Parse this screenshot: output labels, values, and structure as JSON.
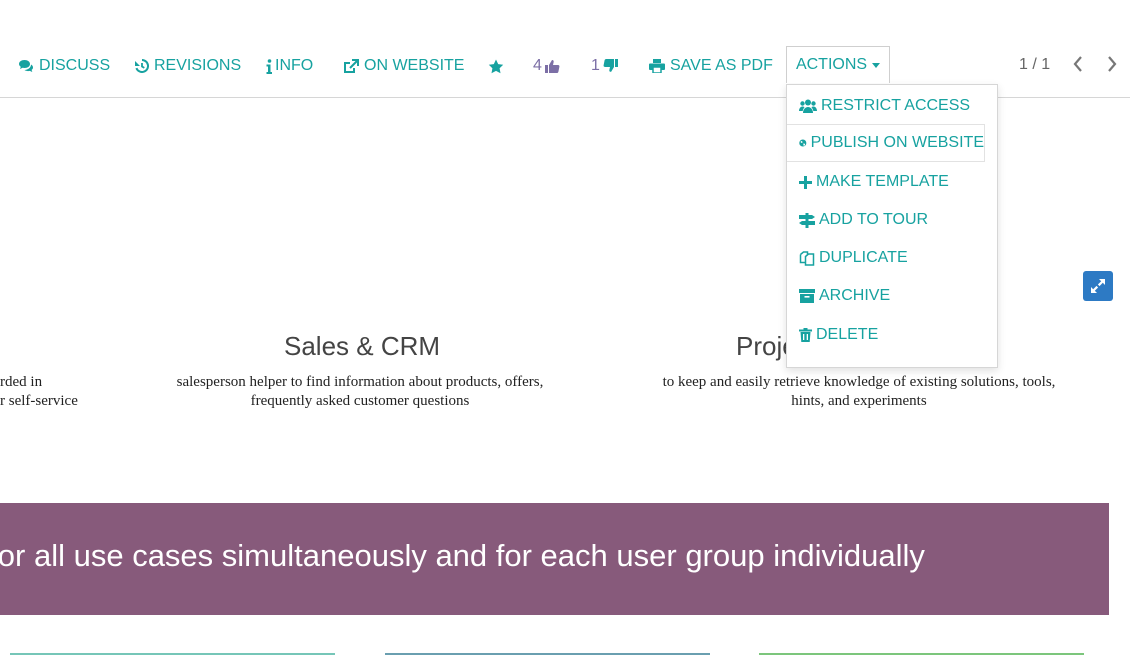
{
  "toolbar": {
    "discuss": "DISCUSS",
    "revisions": "REVISIONS",
    "info": "INFO",
    "on_website": "ON WEBSITE",
    "likes": "4",
    "dislikes": "1",
    "save_pdf": "SAVE AS PDF",
    "actions": "ACTIONS"
  },
  "pager": {
    "text": "1 / 1"
  },
  "actions_menu": {
    "items": [
      {
        "label": "RESTRICT ACCESS",
        "icon": "users-icon"
      },
      {
        "label": "PUBLISH ON WEBSITE",
        "icon": "globe-icon"
      },
      {
        "label": "MAKE TEMPLATE",
        "icon": "plus-icon"
      },
      {
        "label": "ADD TO TOUR",
        "icon": "signpost-icon"
      },
      {
        "label": "DUPLICATE",
        "icon": "copy-icon"
      },
      {
        "label": "ARCHIVE",
        "icon": "archive-icon"
      },
      {
        "label": "DELETE",
        "icon": "trash-icon"
      }
    ]
  },
  "content": {
    "left_text_line1": "rded in",
    "left_text_line2": "r self-service",
    "col2_title": "Sales & CRM",
    "col2_text_line1": "salesperson helper to find information about products, offers,",
    "col2_text_line2": "frequently asked customer questions",
    "col3_title": "Proje",
    "col3_text_line1": "to keep and easily retrieve knowledge of existing solutions, tools,",
    "col3_text_line2": "hints, and experiments",
    "banner": "rves for all use cases simultaneously and for each user group individually"
  },
  "colors": {
    "accent": "#17a2a0",
    "banner": "#875a7b",
    "expand_button": "#2d7ac4"
  }
}
